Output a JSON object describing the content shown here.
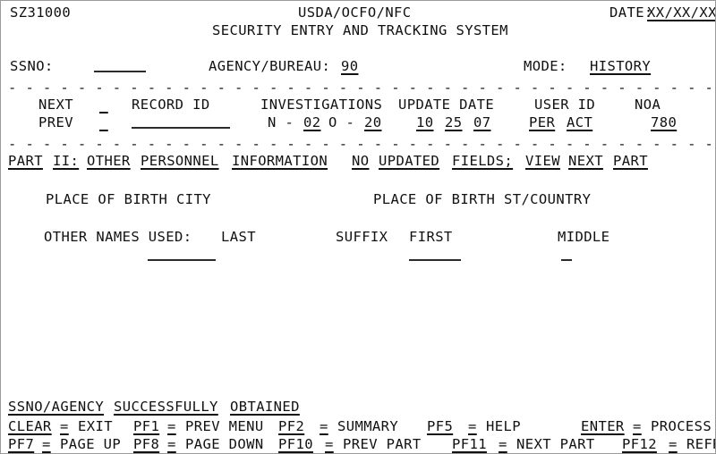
{
  "screen": {
    "program_id": "SZ31000",
    "org_line": "USDA/OCFO/NFC",
    "title": "SECURITY ENTRY AND TRACKING SYSTEM",
    "date_label": "DATE:",
    "date_value": "XX/XX/XX",
    "separator_dash": "- - - - - - - - - - - - - - - - - - - - - - - - - - - - - - - - - - - - - - - - - - - - - - - - - - - - - -"
  },
  "key_fields": {
    "ssno_label": "SSNO:",
    "ssno_value": "",
    "agency_label": "AGENCY/BUREAU:",
    "agency_value": "90",
    "mode_label": "MODE:",
    "mode_value": "HISTORY"
  },
  "record_header": {
    "next_label": "NEXT",
    "prev_label": "PREV",
    "next_marker": "_",
    "prev_marker": "_",
    "record_id_label": "RECORD ID",
    "record_id_value": "",
    "investigations_label": "INVESTIGATIONS",
    "inv_n_label": "N -",
    "inv_n_value": "02",
    "inv_o_label": "O -",
    "inv_o_value": "20",
    "update_date_label": "UPDATE DATE",
    "update_month": "10",
    "update_day": "25",
    "update_year": "07",
    "user_id_label": "USER ID",
    "user_id_per": "PER",
    "user_id_act": "ACT",
    "noa_label": "NOA",
    "noa_value": "780"
  },
  "part_line": {
    "w1": "PART",
    "w2": "II:",
    "w3": "OTHER",
    "w4": "PERSONNEL",
    "w5": "INFORMATION",
    "w6": "NO",
    "w7": "UPDATED",
    "w8": "FIELDS;",
    "w9": "VIEW",
    "w10": "NEXT",
    "w11": "PART"
  },
  "body": {
    "place_of_birth_city_label": "PLACE OF BIRTH CITY",
    "place_of_birth_city_value": "",
    "place_of_birth_state_label": "PLACE OF BIRTH ST/COUNTRY",
    "place_of_birth_state_value": "",
    "other_names_label": "OTHER NAMES USED:",
    "last_label": "LAST",
    "last_value": "",
    "suffix_label": "SUFFIX",
    "suffix_value": "",
    "first_label": "FIRST",
    "first_value": "",
    "middle_label": "MIDDLE",
    "middle_value": ""
  },
  "status": {
    "message_w1": "SSNO/AGENCY",
    "message_w2": "SUCCESSFULLY",
    "message_w3": "OBTAINED"
  },
  "pfkeys": {
    "line1": [
      {
        "key": "CLEAR",
        "eq": "=",
        "action": "EXIT"
      },
      {
        "key": "PF1",
        "eq": "=",
        "action": "PREV MENU"
      },
      {
        "key": "PF2",
        "eq": "=",
        "action": "SUMMARY"
      },
      {
        "key": "PF5",
        "eq": "=",
        "action": "HELP"
      },
      {
        "key": "ENTER",
        "eq": "=",
        "action": "PROCESS"
      }
    ],
    "line2": [
      {
        "key": "PF7",
        "eq": "=",
        "action": "PAGE UP"
      },
      {
        "key": "PF8",
        "eq": "=",
        "action": "PAGE DOWN"
      },
      {
        "key": "PF10",
        "eq": "=",
        "action": "PREV PART"
      },
      {
        "key": "PF11",
        "eq": "=",
        "action": "NEXT PART"
      },
      {
        "key": "PF12",
        "eq": "=",
        "action": "REFRESH"
      }
    ]
  }
}
